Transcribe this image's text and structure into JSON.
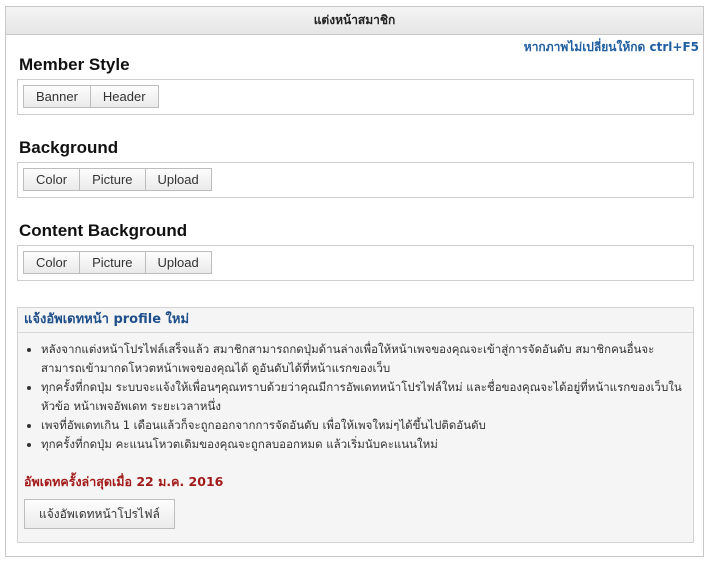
{
  "panel": {
    "title": "แต่งหน้าสมาชิก"
  },
  "hint": "หากภาพไม่เปลี่ยนให้กด ctrl+F5",
  "sections": [
    {
      "title": "Member Style",
      "buttons": [
        "Banner",
        "Header"
      ]
    },
    {
      "title": "Background",
      "buttons": [
        "Color",
        "Picture",
        "Upload"
      ]
    },
    {
      "title": "Content Background",
      "buttons": [
        "Color",
        "Picture",
        "Upload"
      ]
    }
  ],
  "notice": {
    "title": "แจ้งอัพเดทหน้า profile ใหม่",
    "items": [
      "หลังจากแต่งหน้าโปรไฟล์เสร็จแล้ว สมาชิกสามารถกดปุ่มด้านล่างเพื่อให้หน้าเพจของคุณจะเข้าสู่การจัดอันดับ สมาชิกคนอื่นจะสามารถเข้ามากดโหวตหน้าเพจของคุณได้ ดูอันดับได้ที่หน้าแรกของเว็บ",
      "ทุกครั้งที่กดปุ่ม ระบบจะแจ้งให้เพื่อนๆคุณทราบด้วยว่าคุณมีการอัพเดทหน้าโปรไฟล์ใหม่ และชื่อของคุณจะได้อยู่ที่หน้าแรกของเว็บในหัวข้อ หน้าเพจอัพเดท ระยะเวลาหนึ่ง",
      "เพจที่อัพเดทเกิน 1 เดือนแล้วก็จะถูกออกจากการจัดอันดับ เพื่อให้เพจใหม่ๆได้ขึ้นไปติดอันดับ",
      "ทุกครั้งที่กดปุ่ม คะแนนโหวตเดิมของคุณจะถูกลบออกหมด แล้วเริ่มนับคะแนนใหม่"
    ],
    "last_updated": "อัพเดทครั้งล่าสุดเมื่อ 22 ม.ค. 2016",
    "button_label": "แจ้งอัพเดทหน้าโปรไฟล์"
  },
  "colors": {
    "hint": "#1f5ea0",
    "notice_title": "#1f4f8a",
    "updated": "#a31a1a"
  }
}
